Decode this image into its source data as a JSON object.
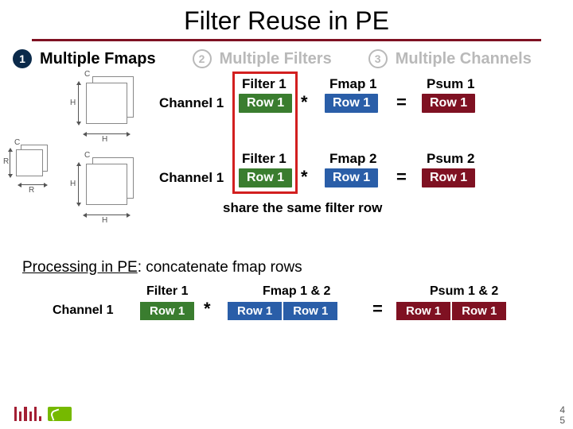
{
  "title": "Filter Reuse in PE",
  "sections": {
    "s1": "Multiple Fmaps",
    "s2": "Multiple Filters",
    "s3": "Multiple Channels",
    "n1": "1",
    "n2": "2",
    "n3": "3"
  },
  "dims": {
    "C": "C",
    "H": "H",
    "R": "R"
  },
  "labels": {
    "channel1": "Channel 1",
    "filter1": "Filter 1",
    "fmap1": "Fmap 1",
    "fmap2": "Fmap 2",
    "psum1": "Psum 1",
    "psum2": "Psum 2",
    "row1": "Row 1",
    "share": "share the same filter row",
    "fmap12": "Fmap 1 & 2",
    "psum12": "Psum 1 & 2"
  },
  "ops": {
    "conv": "*",
    "eq": "="
  },
  "processing": {
    "lead": "Processing in PE",
    "rest": ": concatenate fmap rows"
  },
  "page": {
    "a": "4",
    "b": "5"
  }
}
